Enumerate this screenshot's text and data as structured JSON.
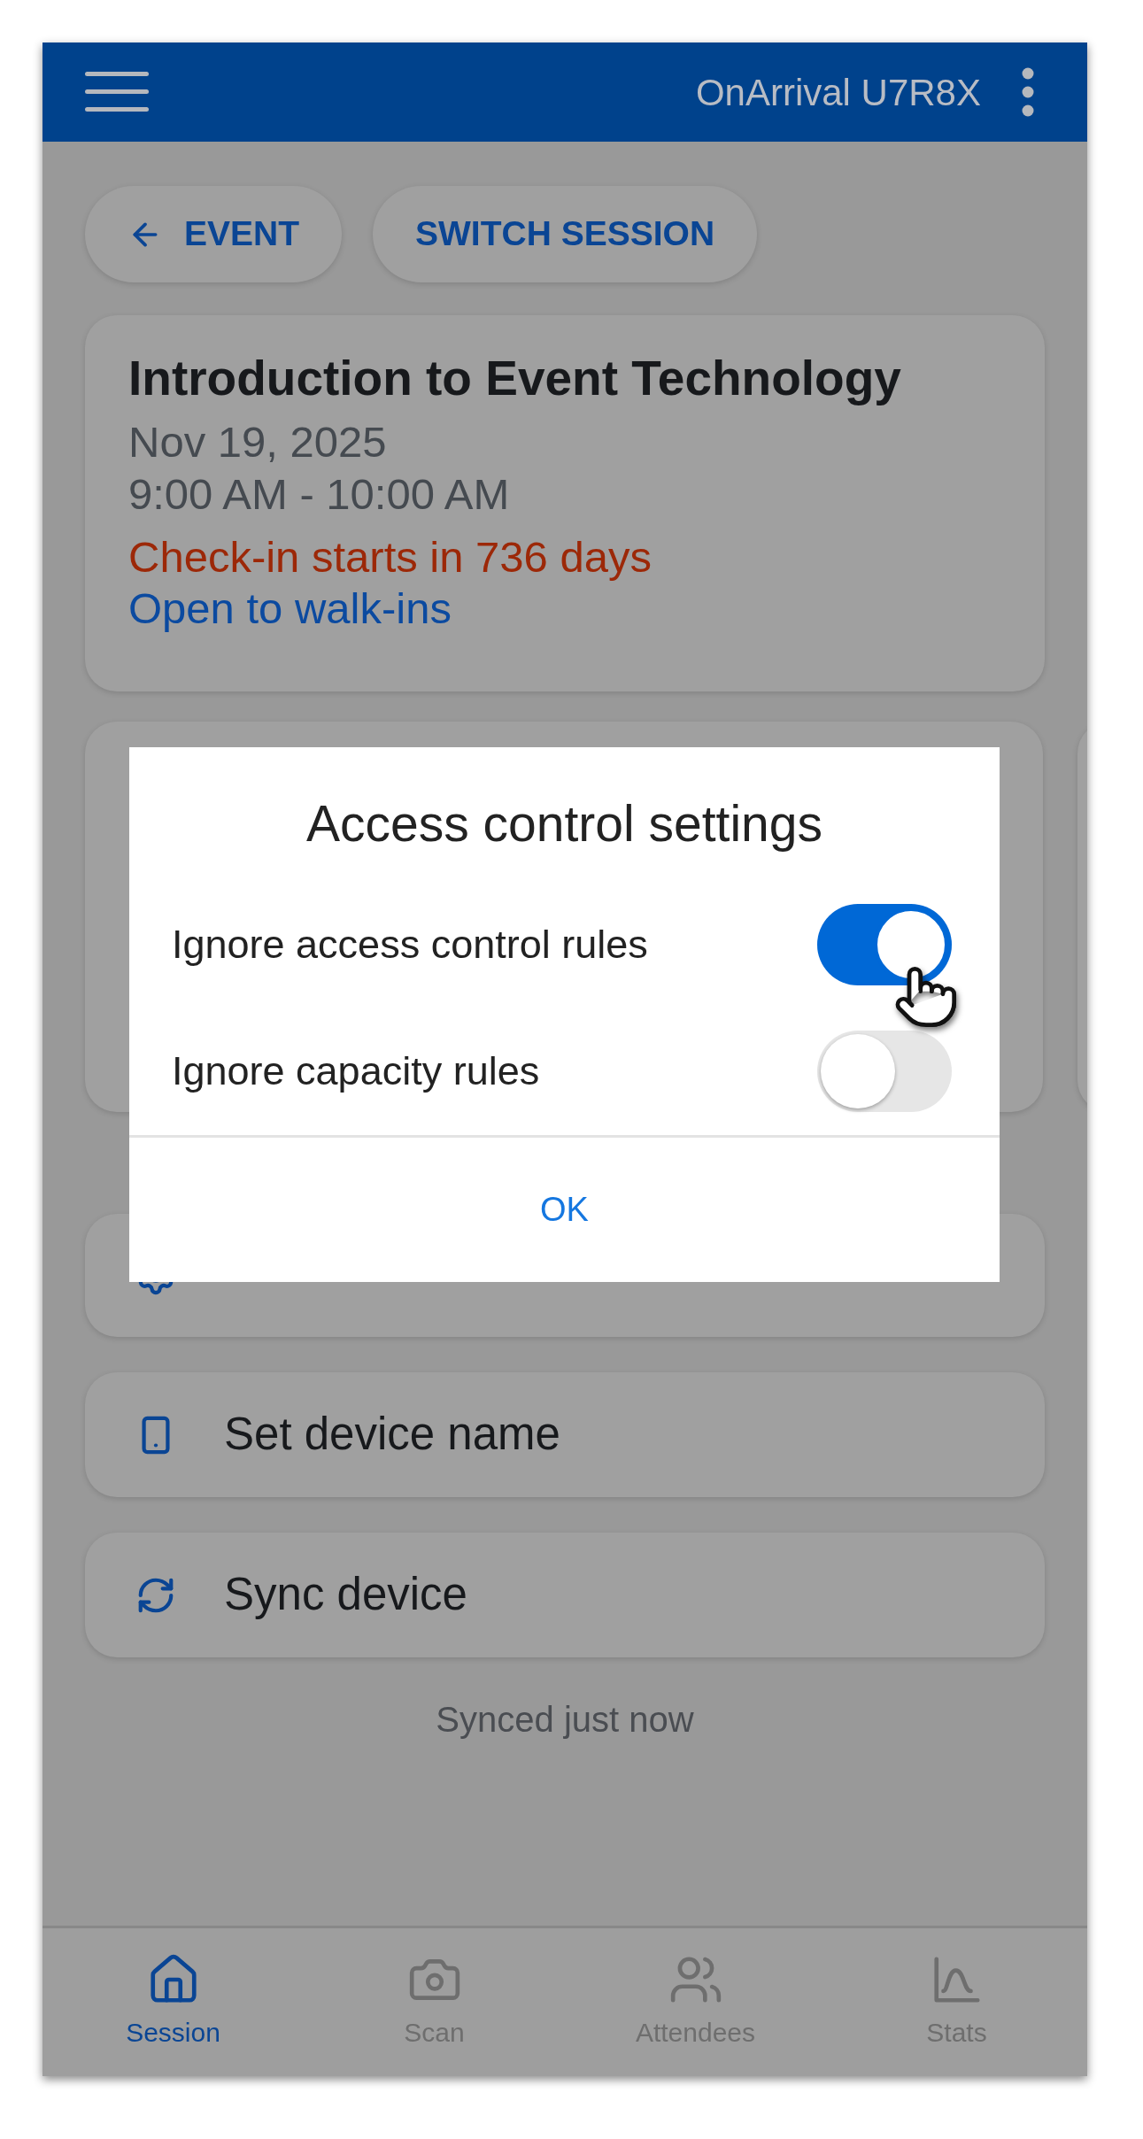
{
  "app_bar": {
    "title": "OnArrival U7R8X"
  },
  "nav_buttons": [
    {
      "label": "EVENT",
      "kind": "back"
    },
    {
      "label": "SWITCH SESSION",
      "kind": "plain"
    }
  ],
  "session": {
    "title": "Introduction to Event Technology",
    "date": "Nov 19, 2025",
    "time": "9:00 AM - 10:00 AM",
    "checkin_status": "Check-in starts in 736 days",
    "walk_in": "Open to walk-ins"
  },
  "actions": [
    {
      "kind": "gear"
    },
    {
      "label": "Set device name",
      "kind": "phone"
    },
    {
      "label": "Sync device",
      "kind": "sync"
    }
  ],
  "sync_status": "Synced just now",
  "dialog": {
    "title": "Access control settings",
    "options": [
      {
        "label": "Ignore access control rules",
        "on": true
      },
      {
        "label": "Ignore capacity rules",
        "on": false
      }
    ],
    "button": "OK"
  },
  "bottom_nav": [
    {
      "label": "Session",
      "kind": "home",
      "selected": true
    },
    {
      "label": "Scan",
      "kind": "camera",
      "selected": false
    },
    {
      "label": "Attendees",
      "kind": "people",
      "selected": false
    },
    {
      "label": "Stats",
      "kind": "stats",
      "selected": false
    }
  ]
}
